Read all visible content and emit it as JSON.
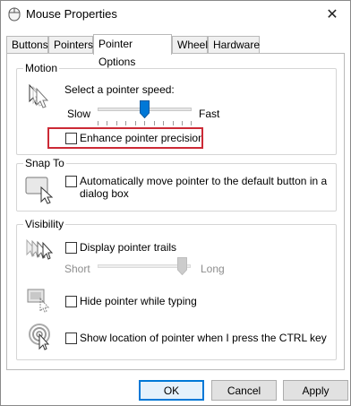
{
  "window": {
    "title": "Mouse Properties",
    "icon": "mouse-icon",
    "close_label": "✕"
  },
  "tabs": [
    {
      "label": "Buttons",
      "active": false
    },
    {
      "label": "Pointers",
      "active": false
    },
    {
      "label": "Pointer Options",
      "active": true
    },
    {
      "label": "Wheel",
      "active": false
    },
    {
      "label": "Hardware",
      "active": false
    }
  ],
  "motion": {
    "legend": "Motion",
    "speed_label": "Select a pointer speed:",
    "slow_label": "Slow",
    "fast_label": "Fast",
    "speed_position": 0.5,
    "enhance_label": "Enhance pointer precision",
    "enhance_checked": false,
    "highlight_color": "#cc2a36"
  },
  "snap": {
    "legend": "Snap To",
    "auto_label_1": "Automatically move pointer to the default button in a",
    "auto_label_2": "dialog box",
    "auto_checked": false
  },
  "visibility": {
    "legend": "Visibility",
    "trails_label": "Display pointer trails",
    "trails_checked": false,
    "short_label": "Short",
    "long_label": "Long",
    "trails_position": 1.0,
    "hide_label": "Hide pointer while typing",
    "hide_checked": false,
    "ctrl_label": "Show location of pointer when I press the CTRL key",
    "ctrl_checked": false
  },
  "buttons": {
    "ok": "OK",
    "cancel": "Cancel",
    "apply": "Apply"
  },
  "colors": {
    "accent": "#0078d7",
    "slider_thumb": "#0078d7",
    "disabled_text": "#8d8d8d"
  }
}
